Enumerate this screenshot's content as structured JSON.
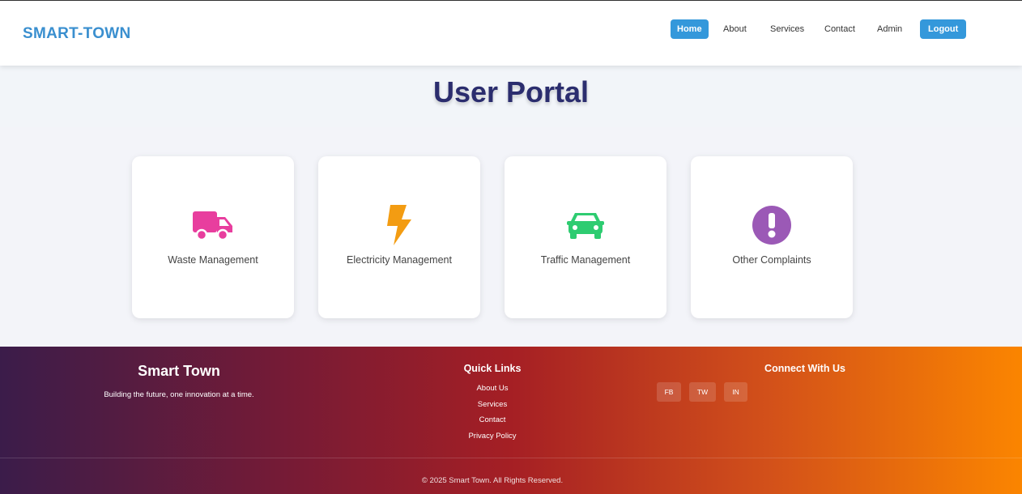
{
  "header": {
    "brand": "SMART-TOWN",
    "nav": [
      {
        "label": "Home",
        "active": true
      },
      {
        "label": "About"
      },
      {
        "label": "Services"
      },
      {
        "label": "Contact"
      },
      {
        "label": "Admin"
      },
      {
        "label": "Logout",
        "highlight": true
      }
    ]
  },
  "hero": {
    "title": "User Portal"
  },
  "cards": [
    {
      "label": "Waste Management",
      "icon": "truck-icon",
      "color": "#e83e9e"
    },
    {
      "label": "Electricity Management",
      "icon": "bolt-icon",
      "color": "#f39c12"
    },
    {
      "label": "Traffic Management",
      "icon": "car-icon",
      "color": "#2ecc71"
    },
    {
      "label": "Other Complaints",
      "icon": "exclamation-circle-icon",
      "color": "#9b59b6"
    }
  ],
  "footer": {
    "title": "Smart Town",
    "tagline": "Building the future, one innovation at a time.",
    "quick_links_title": "Quick Links",
    "quick_links": [
      "About Us",
      "Services",
      "Contact",
      "Privacy Policy"
    ],
    "connect_title": "Connect With Us",
    "social": [
      "FB",
      "TW",
      "IN"
    ],
    "copyright": "© 2025 Smart Town. All Rights Reserved."
  },
  "colors": {
    "brand": "#3a8fcf",
    "accent_button": "#3498db",
    "title": "#2b2d6e"
  }
}
